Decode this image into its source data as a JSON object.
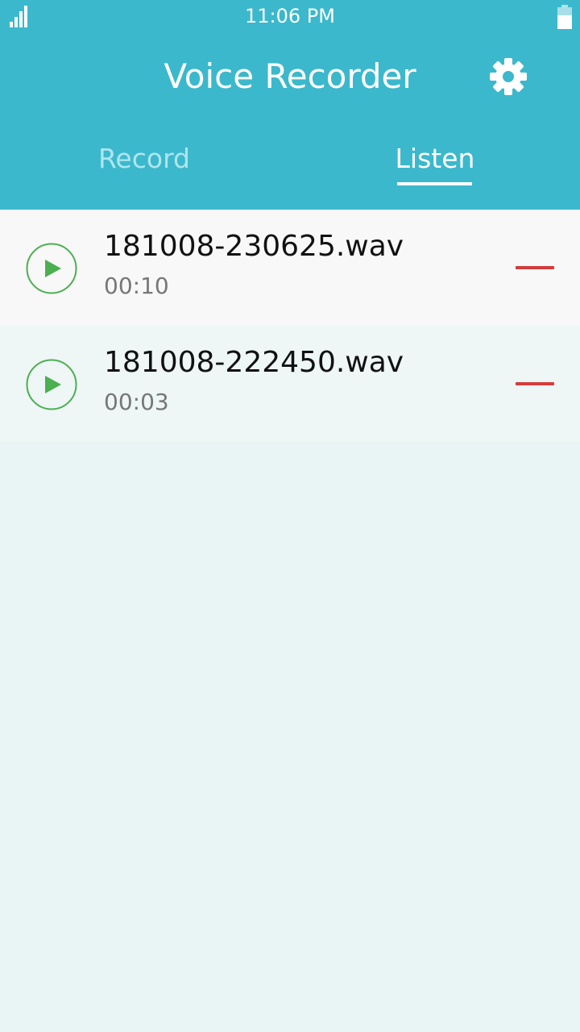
{
  "status_bar": {
    "time": "11:06 PM",
    "signal_icon": "signal-icon",
    "battery_icon": "battery-icon"
  },
  "header": {
    "title": "Voice Recorder",
    "settings_icon": "gear-icon"
  },
  "tabs": [
    {
      "label": "Record",
      "active": false
    },
    {
      "label": "Listen",
      "active": true
    }
  ],
  "recordings": [
    {
      "name": "181008-230625.wav",
      "duration": "00:10",
      "play_icon": "play-icon",
      "delete_icon": "minus-icon"
    },
    {
      "name": "181008-222450.wav",
      "duration": "00:03",
      "play_icon": "play-icon",
      "delete_icon": "minus-icon"
    }
  ],
  "colors": {
    "header_bg": "#3cb8cc",
    "tab_inactive": "#aee6ee",
    "tab_active": "#ffffff",
    "play_green": "#4caf50",
    "delete_red": "#d53b3b",
    "list_bg": "#e9f5f5"
  }
}
